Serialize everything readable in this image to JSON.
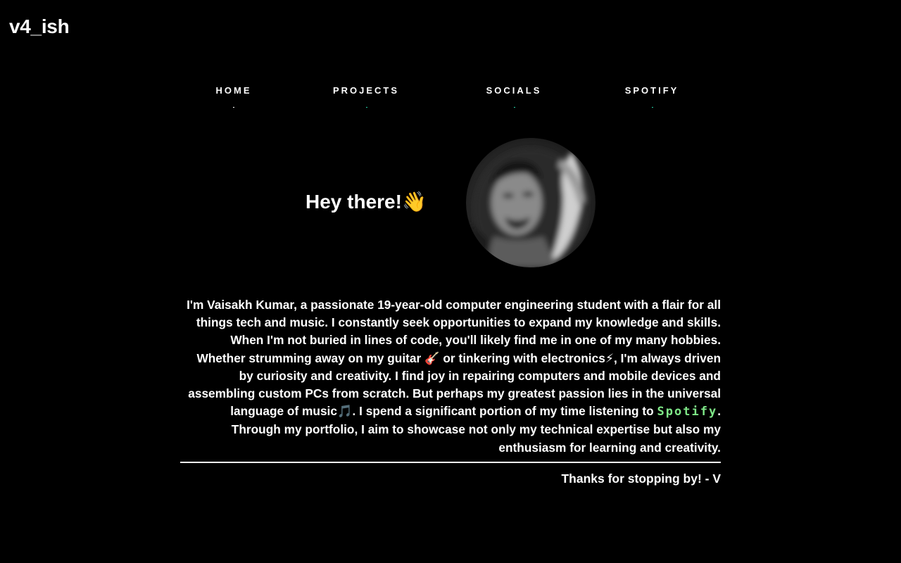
{
  "site": {
    "logo": "v4_ish"
  },
  "nav": {
    "items": [
      {
        "label": "HOME"
      },
      {
        "label": "PROJECTS"
      },
      {
        "label": "SOCIALS"
      },
      {
        "label": "SPOTIFY"
      }
    ],
    "dot_colors": [
      "#ffffff",
      "#22d3a6",
      "#22d3a6",
      "#22d3a6"
    ]
  },
  "hero": {
    "greeting": "Hey there!",
    "greeting_emoji": "👋",
    "avatar_icon": "profile-photo"
  },
  "bio": {
    "part1": "I'm Vaisakh Kumar, a passionate 19-year-old computer engineering student with a flair for all things tech and music. I constantly seek opportunities to expand my knowledge and skills. When I'm not buried in lines of code, you'll likely find me in one of my many hobbies. Whether strumming away on my guitar ",
    "guitar_emoji": "🎸",
    "part2": " or tinkering with electronics",
    "bolt_emoji": "⚡",
    "part3": ", I'm always driven by curiosity and creativity. I find joy in repairing computers and mobile devices and assembling custom PCs from scratch. But perhaps my greatest passion lies in the universal language of music",
    "music_emoji": "🎵",
    "part4": ". I spend a significant portion of my time listening to ",
    "spotify_link": "Spotify",
    "part5": ". Through my portfolio, I aim to showcase not only my technical expertise but also my enthusiasm for learning and creativity."
  },
  "footer": {
    "signoff": "Thanks for stopping by! - V"
  },
  "colors": {
    "background": "#000000",
    "text": "#ffffff",
    "accent_link": "#7ee787",
    "nav_dot_accent": "#22d3a6"
  }
}
